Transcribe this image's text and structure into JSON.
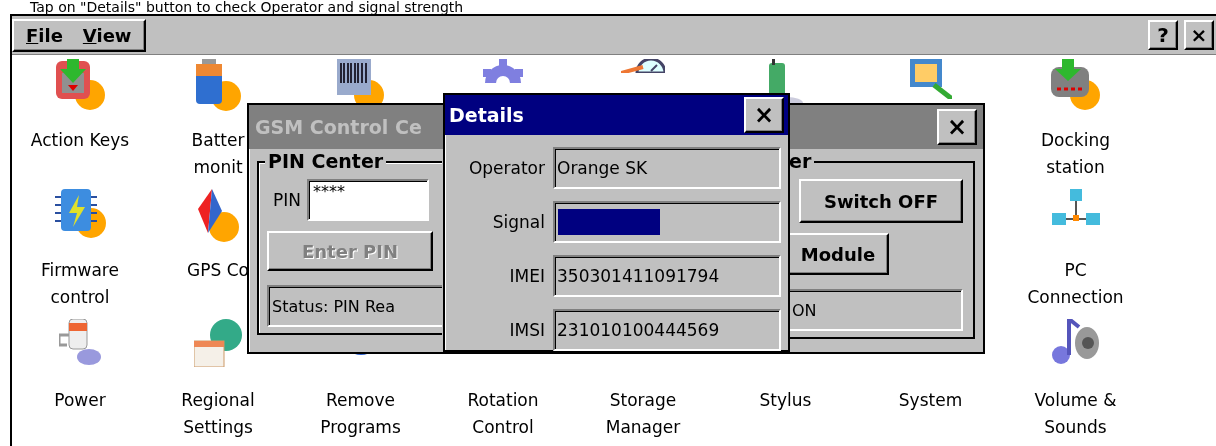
{
  "caption": "Tap on \"Details\" button to check Operator and signal strength",
  "menu": [
    {
      "label": "File"
    },
    {
      "label": "View"
    }
  ],
  "title_buttons": [
    "?",
    "×"
  ],
  "icons": [
    [
      {
        "label": "Action Keys"
      },
      {
        "label": "Batter\nmonit"
      },
      {
        "label": "Docking\nstation"
      }
    ],
    [
      {
        "label": "Firmware\ncontrol"
      },
      {
        "label": "GPS Co"
      },
      {
        "label": "PC\nConnection"
      }
    ],
    [
      {
        "label": "Power"
      },
      {
        "label": "Regional\nSettings"
      },
      {
        "label": "Remove\nPrograms"
      },
      {
        "label": "Rotation\nControl"
      },
      {
        "label": "Storage\nManager"
      },
      {
        "label": "Stylus"
      },
      {
        "label": "System"
      },
      {
        "label": "Volume &\nSounds"
      }
    ]
  ],
  "gsm_window": {
    "title": "GSM Control Ce",
    "active": false,
    "close": "×",
    "pin_group": {
      "legend": "PIN Center",
      "pin_label": "PIN",
      "pin_value": "****",
      "enter_button": {
        "label": "Enter PIN",
        "disabled": true
      },
      "status": "Status: PIN Rea"
    },
    "power_group": {
      "legend": "er",
      "switch_button": "Switch OFF",
      "module_button": "Module",
      "status": "ON"
    }
  },
  "details": {
    "title": "Details",
    "active": true,
    "close": "×",
    "fields": [
      {
        "kind": "text",
        "label": "Operator",
        "value": "Orange SK"
      },
      {
        "kind": "meter",
        "label": "Signal",
        "level": 0.47
      },
      {
        "kind": "text",
        "label": "IMEI",
        "value": "350301411091794"
      },
      {
        "kind": "text",
        "label": "IMSI",
        "value": "231010100444569"
      }
    ]
  }
}
